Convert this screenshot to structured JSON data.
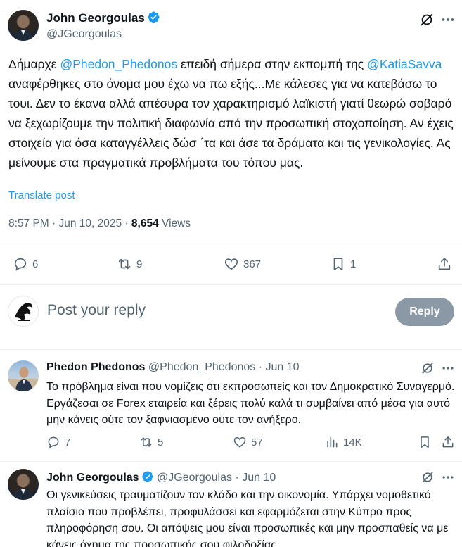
{
  "main_tweet": {
    "author_name": "John Georgoulas",
    "author_handle": "@JGeorgoulas",
    "text_part1": "Δήμαρχε ",
    "mention1": "@Phedon_Phedonos",
    "text_part2": "  επειδή σήμερα στην εκπομπή της ",
    "mention2": "@KatiaSavva",
    "text_part3": "  αναφέρθηκες στο όνομα μου έχω να πω εξής...Με κάλεσες για να κατεβάσω το τουι. Δεν το έκανα αλλά απέσυρα τον χαρακτηρισμό λαϊκιστή γιατί θεωρώ σοβαρό να ξεχωρίζουμε την πολιτική διαφωνία από την προσωπική στοχοποίηση. Αν έχεις στοιχεία για όσα καταγγέλλεις δώσ ΄τα και άσε τα δράματα και τις γενικολογίες. Ας μείνουμε στα πραγματικά προβλήματα του τόπου μας.",
    "translate_label": "Translate post",
    "time": "8:57 PM · Jun 10, 2025 · ",
    "views_count": "8,654",
    "views_label": " Views",
    "replies": "6",
    "reposts": "9",
    "likes": "367",
    "bookmarks": "1"
  },
  "reply_box": {
    "placeholder": "Post your reply",
    "button_label": "Reply"
  },
  "replies": [
    {
      "name": "Phedon Phedonos",
      "handle": "@Phedon_Phedonos",
      "date": " · Jun 10",
      "text": "Το πρόβλημα είναι που νομίζεις ότι εκπροσωπείς και τον Δημοκρατικό Συναγερμό. Εργάζεσαι σε Forex εταιρεία και ξέρεις πολύ καλά τι συμβαίνει από μέσα για αυτό μην κάνεις ούτε τον ξαφνιασμένο ούτε τον ανήξερο.",
      "replies": "7",
      "reposts": "5",
      "likes": "57",
      "views": "14K"
    },
    {
      "name": "John Georgoulas",
      "handle": "@JGeorgoulas",
      "date": " · Jun 10",
      "text": "Οι γενικεύσεις τραυματίζουν τον κλάδο και την οικονομία. Υπάρχει νομοθετικό πλαίσιο που προβλέπει, προφυλάσσει και εφαρμόζεται στην Κύπρο προς πληροφόρηση σου. Οι απόψεις μου είναι προσωπικές και μην προσπαθείς να με κάνεις όχημα της προσωπικής σου φιλοδοξίας."
    }
  ],
  "colors": {
    "accent": "#1d9bf0",
    "secondary_text": "#536471",
    "reply_button_disabled": "#8b98a5"
  }
}
